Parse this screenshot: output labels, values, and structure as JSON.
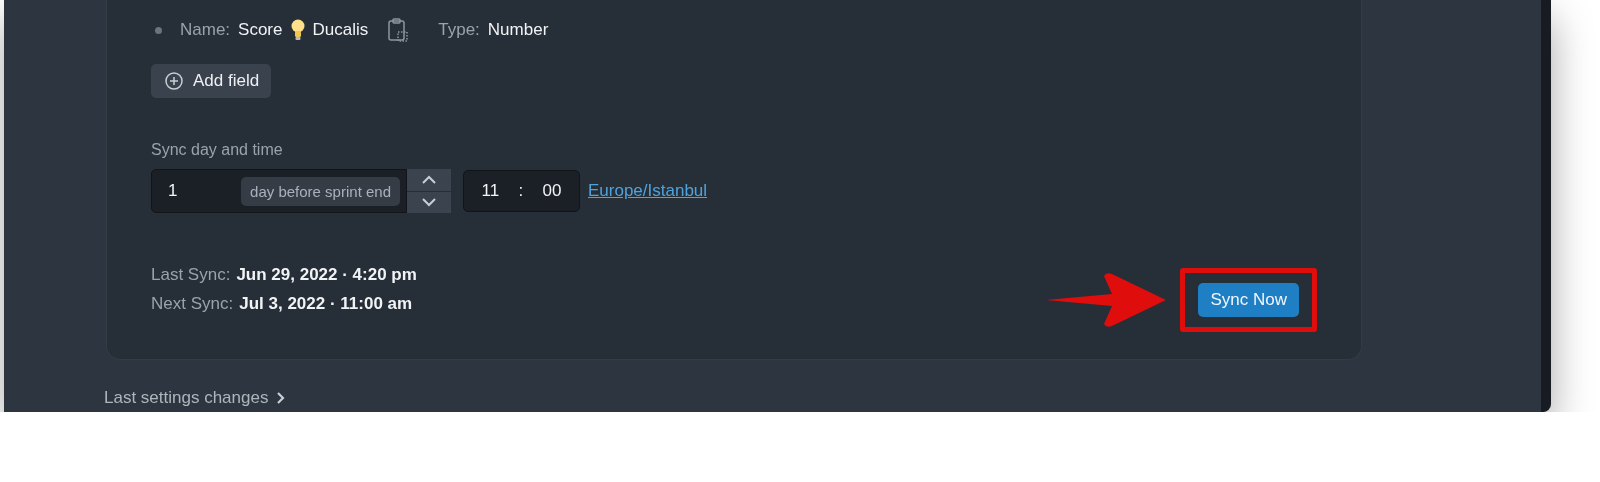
{
  "field": {
    "name_label": "Name:",
    "name_parts": [
      "Score",
      "Ducalis"
    ],
    "type_label": "Type:",
    "type": "Number"
  },
  "add_field_button": {
    "label": "Add field"
  },
  "sync_schedule": {
    "label": "Sync day and time",
    "days_value": "1",
    "days_unit": "day before sprint end",
    "hour": "11",
    "separator": ":",
    "minute": "00",
    "timezone_link": "Europe/Istanbul"
  },
  "sync_status": [
    {
      "label": "Last Sync:",
      "value": "Jun 29, 2022 · 4:20 pm"
    },
    {
      "label": "Next Sync:",
      "value": "Jul 3, 2022 · 11:00 am"
    }
  ],
  "sync_now_button": {
    "label": "Sync Now",
    "highlighted": true
  },
  "footer_link": {
    "label": "Last settings changes"
  }
}
